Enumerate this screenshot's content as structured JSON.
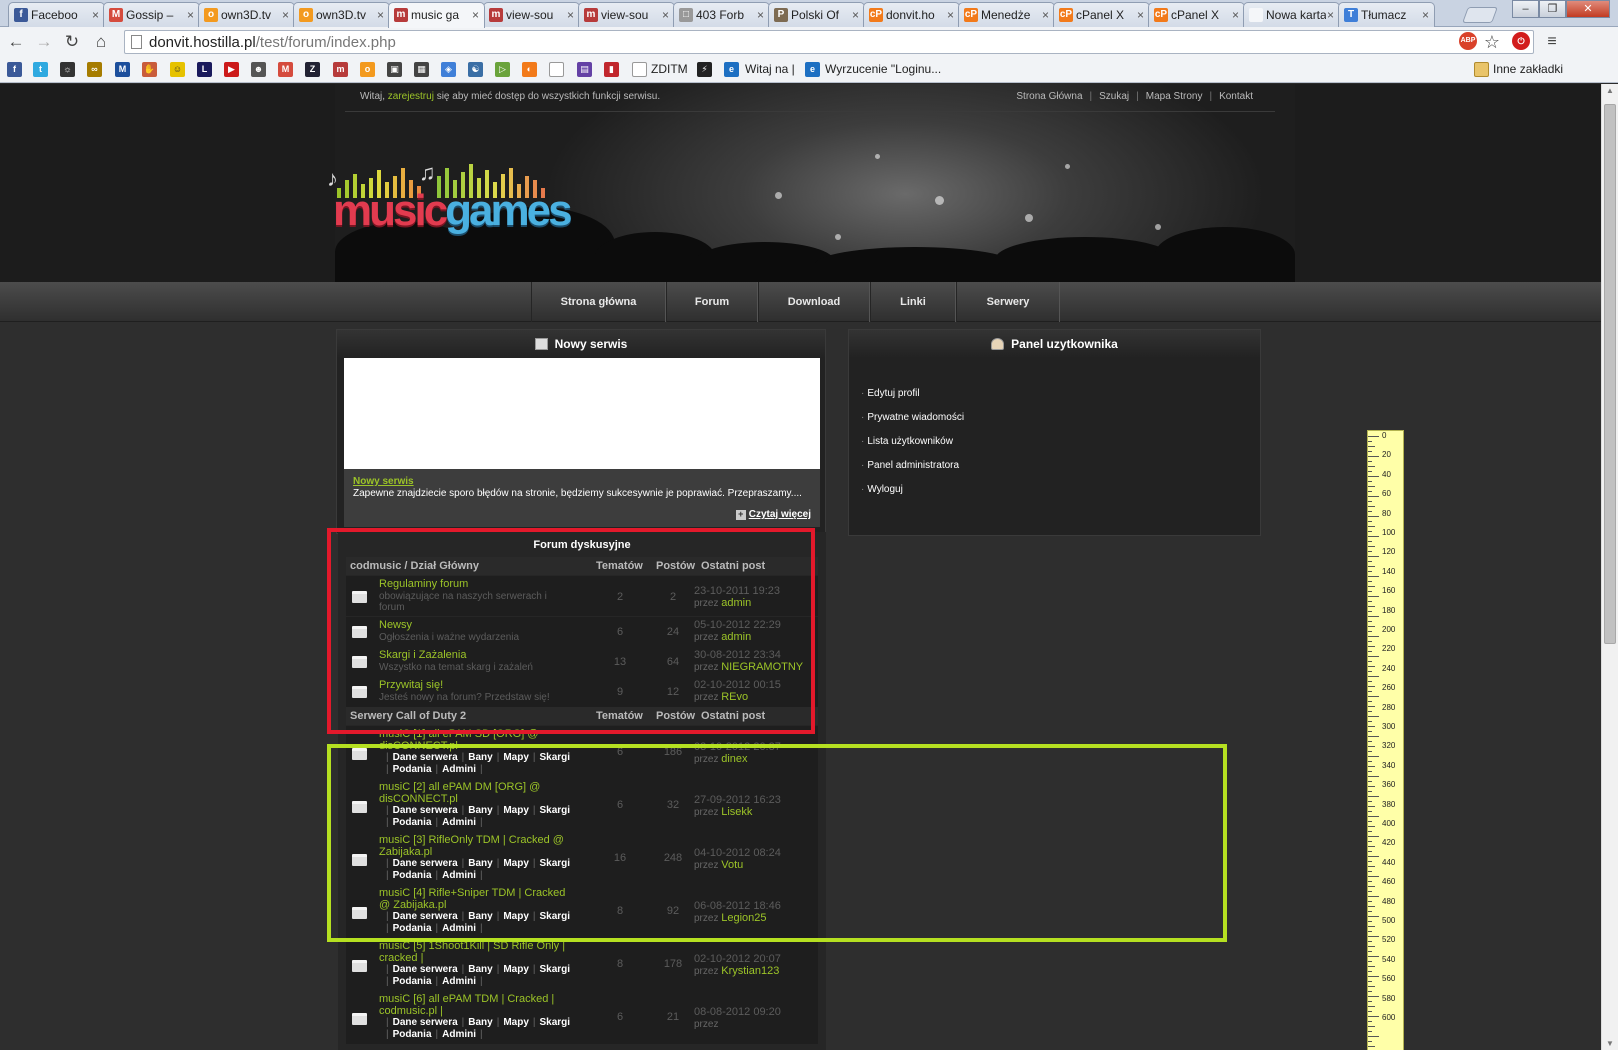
{
  "browser": {
    "tabs": [
      {
        "label": "Faceboo",
        "icon": "f",
        "color": "#3b5998"
      },
      {
        "label": "Gossip –",
        "icon": "M",
        "color": "#d54b3d"
      },
      {
        "label": "own3D.tv",
        "icon": "o",
        "color": "#f39a1f"
      },
      {
        "label": "own3D.tv",
        "icon": "o",
        "color": "#f39a1f"
      },
      {
        "label": "music ga",
        "icon": "m",
        "color": "#b73b3b"
      },
      {
        "label": "view-sou",
        "icon": "m",
        "color": "#b73b3b"
      },
      {
        "label": "view-sou",
        "icon": "m",
        "color": "#b73b3b"
      },
      {
        "label": "403 Forb",
        "icon": "□",
        "color": "#999999"
      },
      {
        "label": "Polski Of",
        "icon": "P",
        "color": "#7d6b52"
      },
      {
        "label": "donvit.ho",
        "icon": "cP",
        "color": "#f27a1a"
      },
      {
        "label": "Menedże",
        "icon": "cP",
        "color": "#f27a1a"
      },
      {
        "label": "cPanel X",
        "icon": "cP",
        "color": "#f27a1a"
      },
      {
        "label": "cPanel X",
        "icon": "cP",
        "color": "#f27a1a"
      },
      {
        "label": "Nowa karta",
        "icon": "",
        "color": "#f4f6f9"
      },
      {
        "label": "Tłumacz",
        "icon": "T",
        "color": "#3f7fd8"
      }
    ],
    "url_host": "donvit.hostilla.pl",
    "url_path": "/test/forum/index.php",
    "bookmarks": {
      "zditm": "ZDITM",
      "witaj": "Witaj na |",
      "wyrzucenie": "Wyrzucenie \"Loginu...",
      "other": "Inne zakładki"
    },
    "ext_abp": "ABP"
  },
  "site": {
    "welcome_pre": "Witaj,",
    "welcome_link": "zarejestruj",
    "welcome_post": "się aby mieć dostęp do wszystkich funkcji serwisu.",
    "toplinks": [
      "Strona Główna",
      "Szukaj",
      "Mapa Strony",
      "Kontakt"
    ],
    "logo_music": "music",
    "logo_games": "games",
    "menu": [
      "Strona główna",
      "Forum",
      "Download",
      "Linki",
      "Serwery"
    ]
  },
  "news": {
    "title": "Nowy serwis",
    "item_title": "Nowy serwis",
    "item_text": "Zapewne znajdziecie sporo błędów na stronie, będziemy sukcesywnie je poprawiać. Przepraszamy....",
    "more": "Czytaj więcej"
  },
  "panel": {
    "title": "Panel uzytkownika",
    "links": [
      "Edytuj profil",
      "Prywatne wiadomości",
      "Lista użytkowników",
      "Panel administratora",
      "Wyloguj"
    ]
  },
  "forum": {
    "title": "Forum dyskusyjne",
    "sections": [
      {
        "name": "codmusic / Dział Główny",
        "col_topics": "Tematów",
        "col_posts": "Postów",
        "col_last": "Ostatni post"
      },
      {
        "name": "Serwery Call of Duty 2",
        "col_topics": "Tematów",
        "col_posts": "Postów",
        "col_last": "Ostatni post"
      }
    ],
    "by": "przez",
    "rows": [
      {
        "name": "Regulaminy forum",
        "desc": "obowiązujące na naszych serwerach i forum",
        "topics": "2",
        "posts": "2",
        "date": "23-10-2011 19:23",
        "user": "admin"
      },
      {
        "name": "Newsy",
        "desc": "Ogłoszenia i ważne wydarzenia",
        "topics": "6",
        "posts": "24",
        "date": "05-10-2012 22:29",
        "user": "admin"
      },
      {
        "name": "Skargi i Zażalenia",
        "desc": "Wszystko na temat skarg i zażaleń",
        "topics": "13",
        "posts": "64",
        "date": "30-08-2012 23:34",
        "user": "NIEGRAMOTNY"
      },
      {
        "name": "Przywitaj się!",
        "desc": "Jesteś nowy na forum? Przedstaw się!",
        "topics": "9",
        "posts": "12",
        "date": "02-10-2012 00:15",
        "user": "REvo"
      }
    ],
    "server_links": [
      "Dane serwera",
      "Bany",
      "Mapy",
      "Skargi",
      "Podania",
      "Admini"
    ],
    "servers": [
      {
        "name": "musiC [1] all ePAM SD [ORG] @ disCONNECT.pl",
        "topics": "6",
        "posts": "186",
        "date": "03-10-2012 20:37",
        "user": "dinex"
      },
      {
        "name": "musiC [2] all ePAM DM [ORG] @ disCONNECT.pl",
        "topics": "6",
        "posts": "32",
        "date": "27-09-2012 16:23",
        "user": "Lisekk"
      },
      {
        "name": "musiC [3] RifleOnly TDM | Cracked @ Zabijaka.pl",
        "topics": "16",
        "posts": "248",
        "date": "04-10-2012 08:24",
        "user": "Votu"
      },
      {
        "name": "musiC [4] Rifle+Sniper TDM | Cracked @ Zabijaka.pl",
        "topics": "8",
        "posts": "92",
        "date": "06-08-2012 18:46",
        "user": "Legion25"
      },
      {
        "name": "musiC [5] 1Shoot1Kill | SD Rifle Only | cracked |",
        "topics": "8",
        "posts": "178",
        "date": "02-10-2012 20:07",
        "user": "Krystian123"
      },
      {
        "name": "musiC [6] all ePAM TDM | Cracked | codmusic.pl |",
        "topics": "6",
        "posts": "21",
        "date": "08-08-2012 09:20",
        "user": ""
      }
    ]
  },
  "ruler": [
    "0",
    "20",
    "40",
    "60",
    "80",
    "100",
    "120",
    "140",
    "160",
    "180",
    "200",
    "220",
    "240",
    "260",
    "280",
    "300",
    "320",
    "340",
    "360",
    "380",
    "400",
    "420",
    "440",
    "460",
    "480",
    "500",
    "520",
    "540",
    "560",
    "580",
    "600"
  ]
}
